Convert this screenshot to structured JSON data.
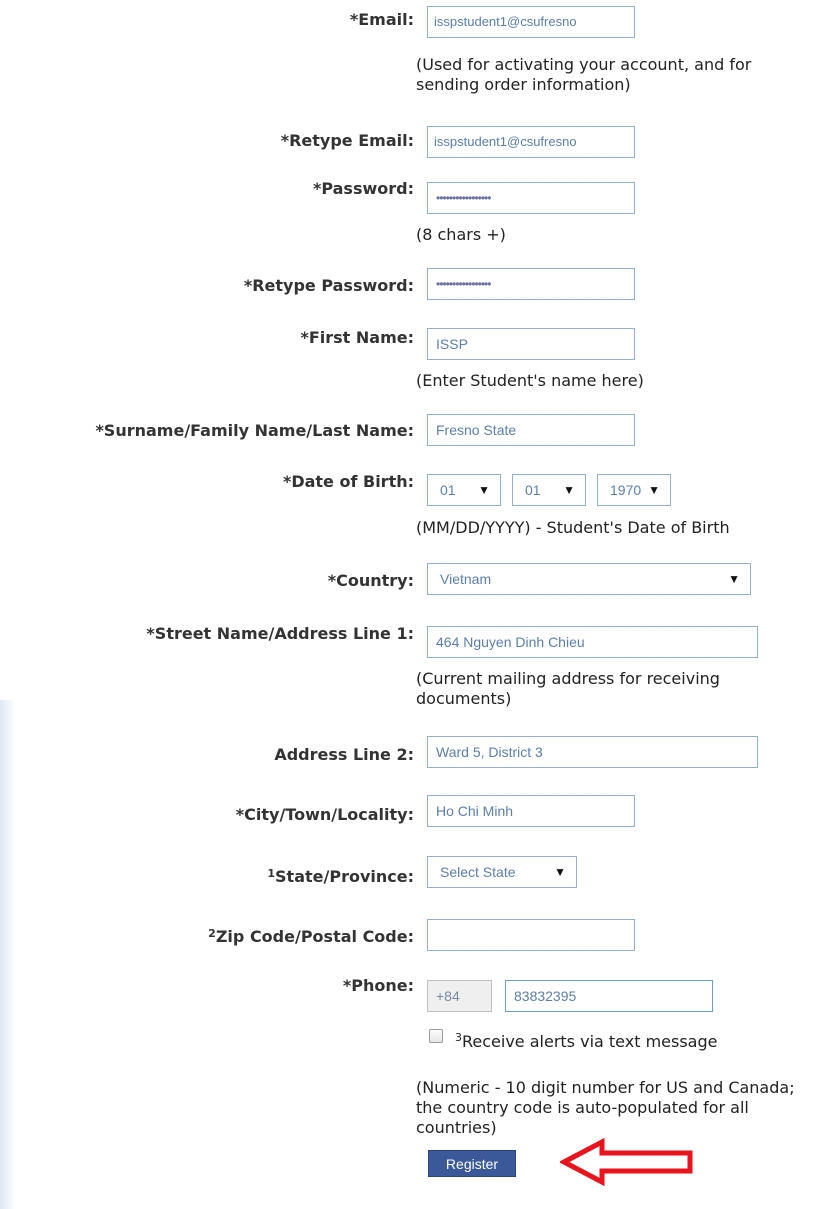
{
  "form": {
    "email": {
      "label": "*Email:",
      "value": "isspstudent1@csufresno",
      "help": "(Used for activating your account, and for sending order information)"
    },
    "retype_email": {
      "label": "*Retype Email:",
      "value": "isspstudent1@csufresno"
    },
    "password": {
      "label": "*Password:",
      "value": "•••••••••••••••••",
      "help": "(8 chars +)"
    },
    "retype_password": {
      "label": "*Retype Password:",
      "value": "•••••••••••••••••"
    },
    "first_name": {
      "label": "*First Name:",
      "value": "ISSP",
      "help": "(Enter Student's name here)"
    },
    "last_name": {
      "label": "*Surname/Family Name/Last Name:",
      "value": "Fresno State"
    },
    "dob": {
      "label": "*Date of Birth:",
      "month": "01",
      "day": "01",
      "year": "1970",
      "help": "(MM/DD/YYYY) - Student's Date of Birth"
    },
    "country": {
      "label": "*Country:",
      "value": "Vietnam"
    },
    "address1": {
      "label": "*Street Name/Address Line 1:",
      "value": "464 Nguyen Dinh Chieu",
      "help": "(Current mailing address for receiving documents)"
    },
    "address2": {
      "label": "Address Line 2:",
      "value": "Ward 5, District 3"
    },
    "city": {
      "label": "*City/Town/Locality:",
      "value": "Ho Chi Minh"
    },
    "state": {
      "sup": "1",
      "label": "State/Province:",
      "value": "Select State"
    },
    "zip": {
      "sup": "2",
      "label": "Zip Code/Postal Code:",
      "value": ""
    },
    "phone": {
      "label": "*Phone:",
      "country_code": "+84",
      "value": "83832395",
      "help": "(Numeric - 10 digit number for US and Canada; the country code is auto-populated for all countries)"
    },
    "sms": {
      "sup": "3",
      "label": "Receive alerts via text message",
      "checked": false
    },
    "register_label": "Register"
  },
  "colors": {
    "field_border": "#8fb1d8",
    "field_text": "#5a7fb0",
    "button_bg": "#3b5998",
    "arrow": "#e8131b"
  },
  "icons": {
    "select_arrow": "triangle-down-icon",
    "annotation": "red-arrow-left-icon"
  }
}
